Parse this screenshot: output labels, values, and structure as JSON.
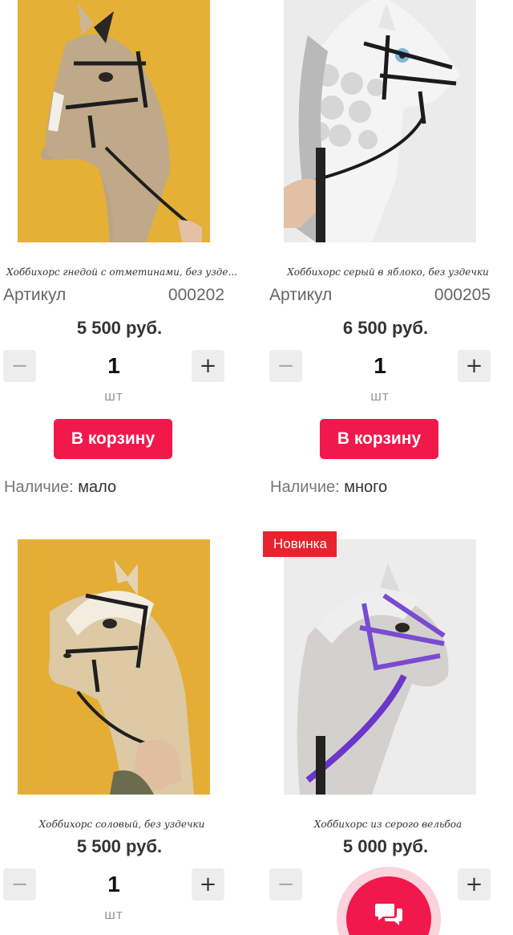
{
  "products": [
    {
      "title": "Хоббихорс гнедой с отметинами, без узде...",
      "sku_label": "Артикул",
      "sku": "000202",
      "price": "5 500 руб.",
      "qty": "1",
      "unit": "шт",
      "cart_label": "В корзину",
      "stock_label": "Наличие:",
      "stock_value": "мало"
    },
    {
      "title": "Хоббихорс серый в яблоко, без уздечки",
      "sku_label": "Артикул",
      "sku": "000205",
      "price": "6 500 руб.",
      "qty": "1",
      "unit": "шт",
      "cart_label": "В корзину",
      "stock_label": "Наличие:",
      "stock_value": "много"
    },
    {
      "title": "Хоббихорс соловый, без уздечки",
      "price": "5 500 руб.",
      "qty": "1",
      "unit": "шт"
    },
    {
      "badge": "Новинка",
      "title": "Хоббихорс из серого вельбоа",
      "price": "5 000 руб."
    }
  ],
  "stepper": {
    "minus": "−",
    "plus": "+"
  },
  "colors": {
    "accent": "#f1184c",
    "badge": "#e8232f"
  }
}
